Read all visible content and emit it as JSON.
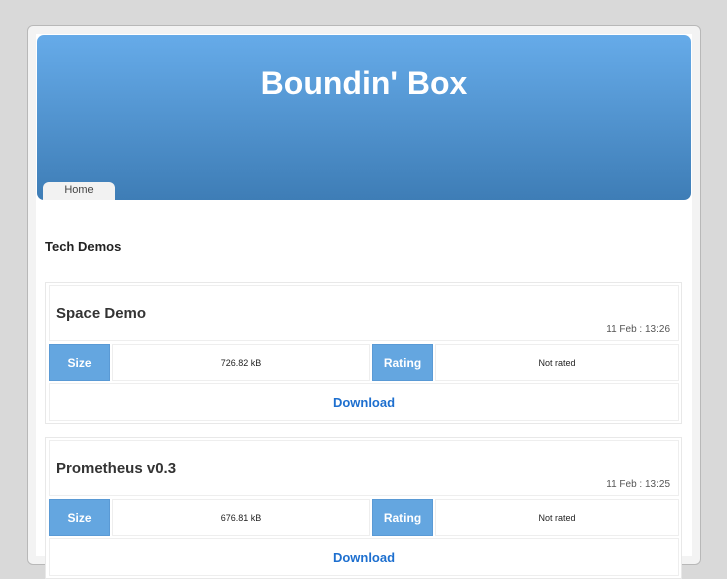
{
  "site": {
    "title": "Boundin' Box",
    "nav": [
      {
        "label": "Home"
      }
    ]
  },
  "section_title": "Tech Demos",
  "labels": {
    "size": "Size",
    "rating": "Rating",
    "download": "Download"
  },
  "demos": [
    {
      "name": "Space Demo",
      "date": "11 Feb : 13:26",
      "size": "726.82 kB",
      "rating": "Not rated"
    },
    {
      "name": "Prometheus v0.3",
      "date": "11 Feb : 13:25",
      "size": "676.81 kB",
      "rating": "Not rated"
    }
  ]
}
